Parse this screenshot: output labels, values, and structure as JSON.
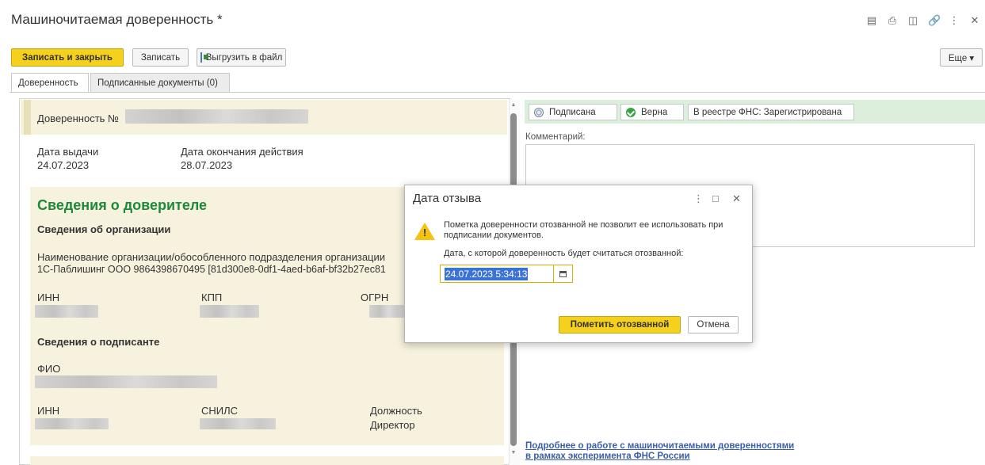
{
  "window": {
    "title": "Машиночитаемая доверенность *",
    "icons": [
      "save-icon",
      "print-icon",
      "preview-icon",
      "link-icon",
      "more-icon",
      "close-icon"
    ]
  },
  "toolbar": {
    "save_close": "Записать и закрыть",
    "save": "Записать",
    "export": "Выгрузить в файл",
    "more": "Еще ▾"
  },
  "tabs": [
    {
      "label": "Доверенность"
    },
    {
      "label": "Подписанные документы (0)"
    }
  ],
  "doc": {
    "number_label": "Доверенность №",
    "issue_date_label": "Дата выдачи",
    "issue_date": "24.07.2023",
    "end_date_label": "Дата окончания действия",
    "end_date": "28.07.2023",
    "principal_title": "Сведения о доверителе",
    "org_info_title": "Сведения об организации",
    "org_name_label": "Наименование организации/обособленного подразделения организации",
    "org_name": "1С-Паблишинг ООО 9864398670495 [81d300e8-0df1-4aed-b6af-bf32b27ec81",
    "inn_label": "ИНН",
    "kpp_label": "КПП",
    "ogrn_label": "ОГРН",
    "signer_title": "Сведения о подписанте",
    "fio_label": "ФИО",
    "signer_inn_label": "ИНН",
    "snils_label": "СНИЛС",
    "position_label": "Должность",
    "position": "Директор"
  },
  "status": {
    "signed": "Подписана",
    "valid": "Верна",
    "registry": "В реестре ФНС: Зарегистрирована"
  },
  "comment_label": "Комментарий:",
  "link": {
    "line1": "Подробнее о работе с машиночитаемыми доверенностями",
    "line2": "в рамках эксперимента ФНС России"
  },
  "dialog": {
    "title": "Дата отзыва",
    "warning": "Пометка доверенности отозванной не позволит ее использовать при подписании документов.",
    "date_prompt": "Дата, с которой доверенность будет считаться отозванной:",
    "date_value": "24.07.2023  5:34:13",
    "ok": "Пометить отозванной",
    "cancel": "Отмена"
  },
  "colors": {
    "accent_yellow": "#f5d01d",
    "section_bg": "#f7f2dd",
    "section_title": "#1d8a3b",
    "status_bg": "#dcefdc",
    "selection": "#3b72d6",
    "link": "#3b5ea8"
  }
}
